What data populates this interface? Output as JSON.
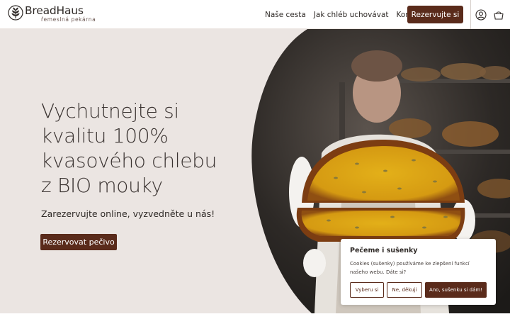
{
  "header": {
    "brand_name": "BreadHaus",
    "brand_tagline": "řemeslná pekárna",
    "nav": [
      {
        "label": "Naše cesta"
      },
      {
        "label": "Jak chléb uchovávat"
      },
      {
        "label": "Kontakt"
      }
    ],
    "reserve_label": "Rezervujte si",
    "icons": [
      "user-icon",
      "basket-icon"
    ]
  },
  "hero": {
    "title_lines": [
      "Vychutnejte si",
      "kvalitu 100%",
      "kvasového chlebu",
      "z BIO mouky"
    ],
    "subtitle": "Zarezervujte online, vyzvedněte u nás!",
    "button_label": "Rezervovat pečivo"
  },
  "cookie_banner": {
    "title": "Pečeme i sušenky",
    "text": "Cookies (sušenky) používáme ke zlepšení funkcí našeho webu. Dáte si?",
    "buttons": {
      "select": "Vyberu si",
      "decline": "Ne, děkuji",
      "accept": "Ano, sušenku si dám!"
    }
  },
  "colors": {
    "accent": "#5a2b1b",
    "hero_background": "#ebe5e2",
    "text": "#2f2a27"
  }
}
